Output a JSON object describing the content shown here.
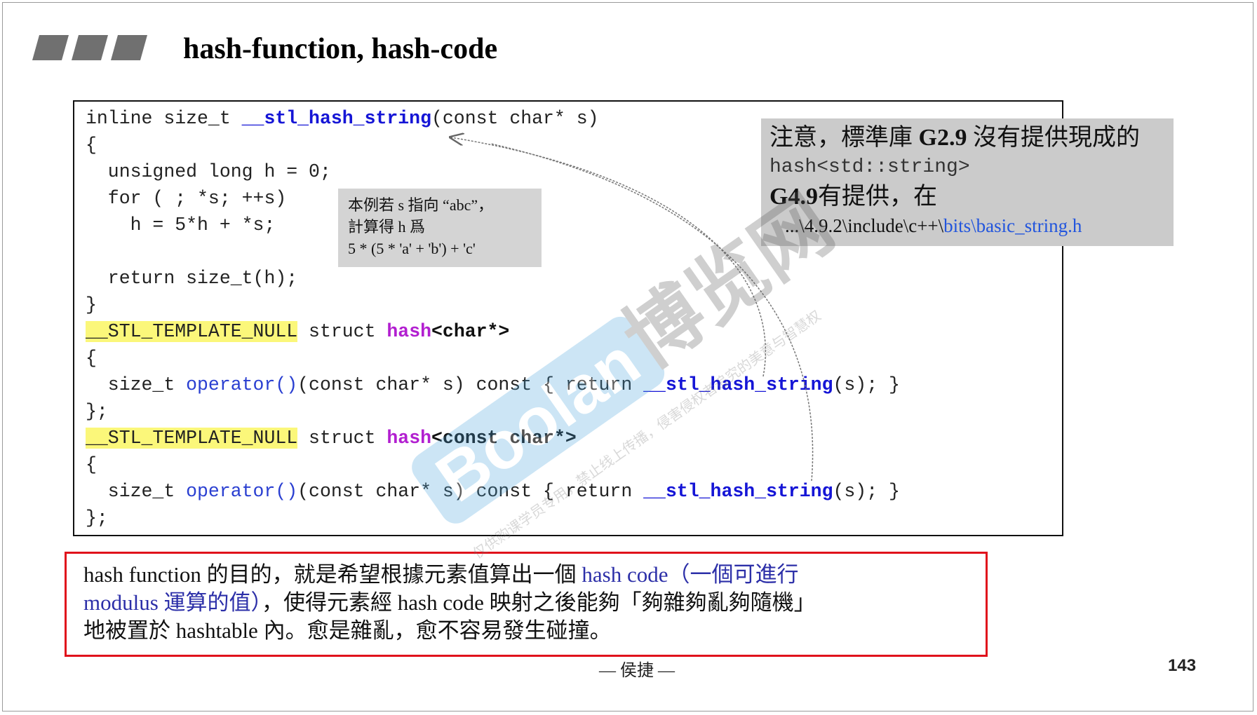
{
  "slide": {
    "title": "hash-function, hash-code",
    "page_number": "143",
    "footer": "— 侯捷 —"
  },
  "code": {
    "line1": {
      "a": "inline size_t ",
      "b": "__stl_hash_string",
      "c": "(const char* s)"
    },
    "line2": "{",
    "line3": "  unsigned long h = 0;",
    "line4": "  for ( ; *s; ++s)",
    "line5": "    h = 5*h + *s;",
    "line6": "  return size_t(h);",
    "line7": "}",
    "line8": {
      "macro": "__STL_TEMPLATE_NULL",
      "kw": " struct ",
      "name": "hash",
      "targ": "<char*>"
    },
    "line9": "{",
    "line10": {
      "a": "  size_t ",
      "op": "operator()",
      "b": "(const char* s) const { return ",
      "fn": "__stl_hash_string",
      "c": "(s); }"
    },
    "line11": "};",
    "line12": {
      "macro": "__STL_TEMPLATE_NULL",
      "kw": " struct ",
      "name": "hash",
      "targ": "<const char*>"
    },
    "line13": "{",
    "line14": {
      "a": "  size_t ",
      "op": "operator()",
      "b": "(const char* s) const { return ",
      "fn": "__stl_hash_string",
      "c": "(s); }"
    },
    "line15": "};"
  },
  "note_example": {
    "line1": "本例若 s 指向 “abc”，",
    "line2": "計算得 h 爲",
    "line3": "5 * (5 * 'a' + 'b') + 'c'"
  },
  "note_library": {
    "line1_a": "注意，標準庫 ",
    "line1_b": "G2.9",
    "line1_c": " 沒有提供現成的",
    "line2": "hash<std::string>",
    "line3_a": "G4.9",
    "line3_b": "有提供，在",
    "line4_a": "...\\4.9.2\\include\\c++\\",
    "line4_b": "bits\\basic_string.h"
  },
  "explanation": {
    "l1_a": "hash function 的目的，就是希望根據元素值算出一個 ",
    "l1_b": "hash code（一個可進行",
    "l2_a": "modulus 運算的值）",
    "l2_b": "，使得元素經 hash code 映射之後能夠「夠雜夠亂夠隨機」",
    "l3": "地被置於 hashtable 內。愈是雜亂，愈不容易發生碰撞。"
  },
  "watermark": {
    "brand": "Boolan",
    "cn": "博览网",
    "fine_print": "仅供购课学员专用，禁止线上传播，侵害侵权者追究的美意与智慧权"
  }
}
